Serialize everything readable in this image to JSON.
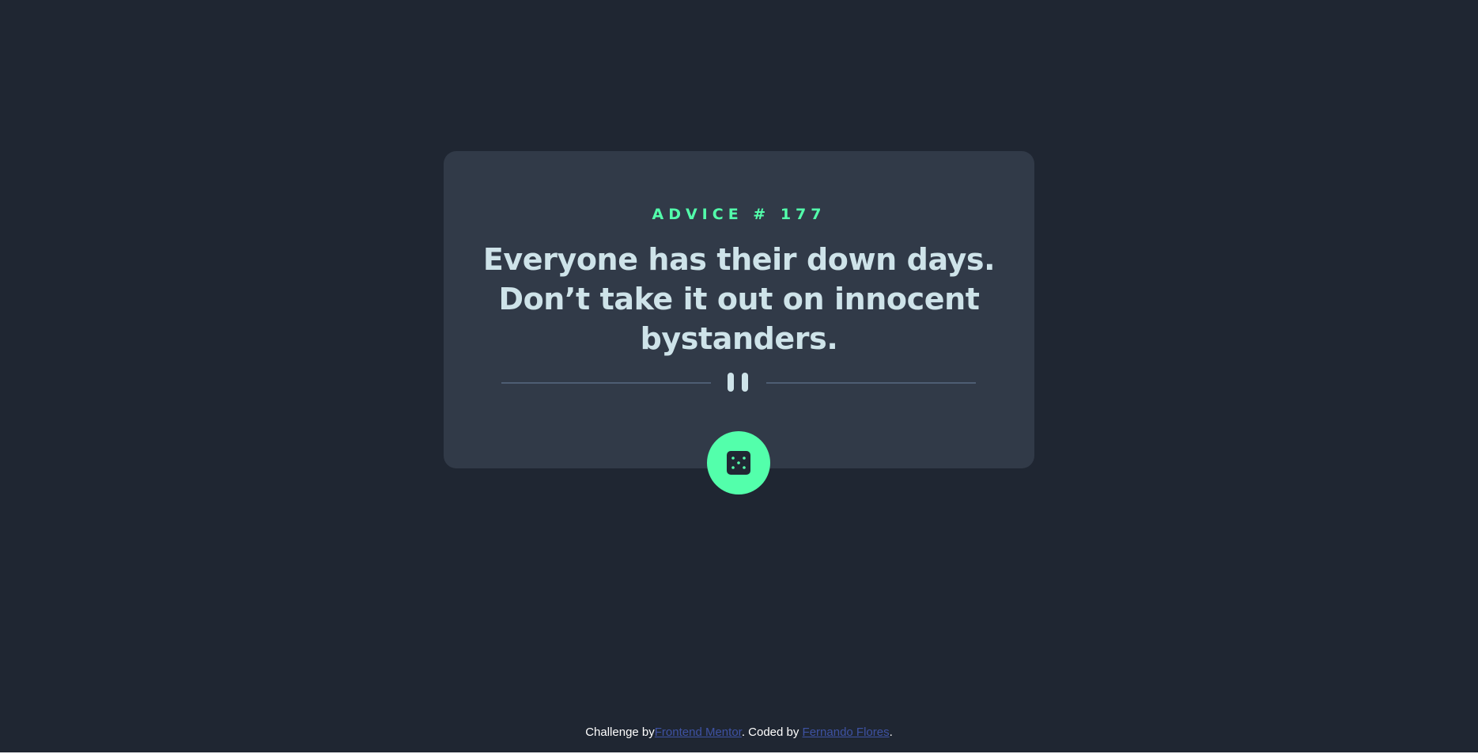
{
  "card": {
    "heading": "ADVICE # 177",
    "quote": "Everyone has their down days. Don’t take it out on innocent bystanders.",
    "divider_icon": "pause-icon",
    "dice_button_icon": "dice-icon"
  },
  "footer": {
    "challenge_text": "Challenge by",
    "challenge_link": "Frontend Mentor",
    "coded_text": ". Coded by ",
    "author_link": "Fernando Flores",
    "end_text": "."
  },
  "colors": {
    "background": "#1f2632",
    "card": "#313a48",
    "accent": "#53ffab",
    "quote": "#cee3e9",
    "divider": "#4e5d73",
    "link": "#3e52a3"
  }
}
